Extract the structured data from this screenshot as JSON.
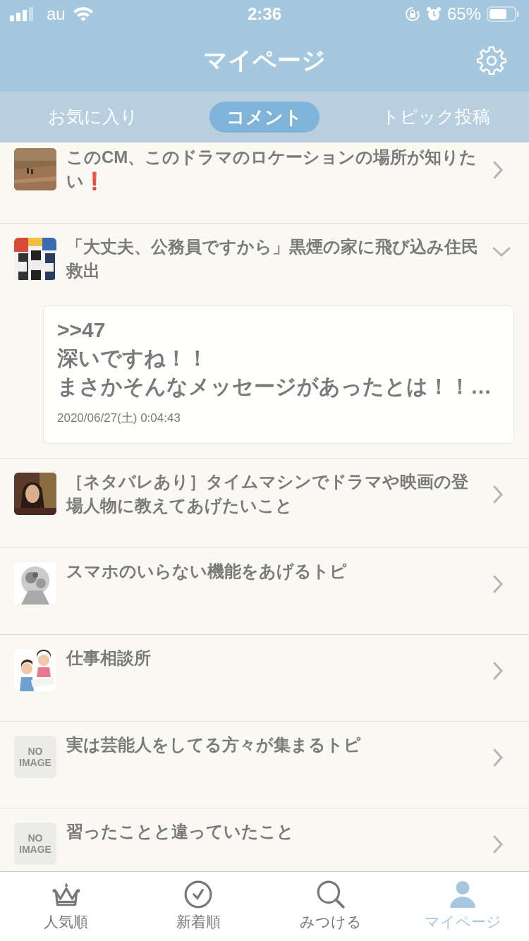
{
  "status_bar": {
    "carrier": "au",
    "time": "2:36",
    "battery": "65%"
  },
  "header": {
    "title": "マイページ"
  },
  "tabs": [
    {
      "label": "お気に入り",
      "selected": false
    },
    {
      "label": "コメント",
      "selected": true
    },
    {
      "label": "トピック投稿",
      "selected": false
    }
  ],
  "topics": [
    {
      "title": "このCM、このドラマのロケーションの場所が知りたい❗",
      "expanded": false
    },
    {
      "title": "「大丈夫、公務員ですから」黒煙の家に飛び込み住民救出",
      "expanded": true,
      "comment": {
        "lines": [
          ">>47",
          "深いですね！！",
          "まさかそんなメッセージがあったとは！！…"
        ],
        "date": "2020/06/27(土) 0:04:43"
      }
    },
    {
      "title": "［ネタバレあり］タイムマシンでドラマや映画の登場人物に教えてあげたいこと",
      "expanded": false
    },
    {
      "title": "スマホのいらない機能をあげるトピ",
      "expanded": false
    },
    {
      "title": "仕事相談所",
      "expanded": false
    },
    {
      "title": "実は芸能人をしてる方々が集まるトピ",
      "thumbnail": {
        "kind": "placeholder",
        "lines": [
          "NO",
          "IMAGE"
        ]
      },
      "expanded": false
    },
    {
      "title": "習ったことと違っていたこと",
      "thumbnail": {
        "kind": "placeholder",
        "lines": [
          "NO",
          "IMAGE"
        ]
      },
      "expanded": false
    }
  ],
  "bottom_nav": [
    {
      "label": "人気順",
      "selected": false
    },
    {
      "label": "新着順",
      "selected": false
    },
    {
      "label": "みつける",
      "selected": false
    },
    {
      "label": "マイページ",
      "selected": true
    }
  ]
}
